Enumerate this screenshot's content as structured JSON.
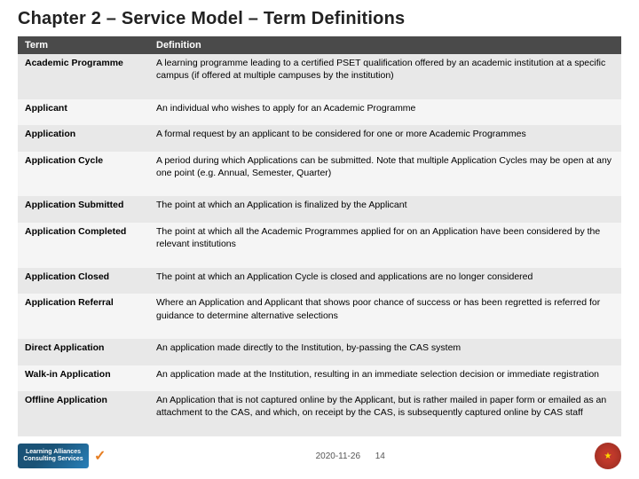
{
  "header": {
    "title": "Chapter 2 – Service Model – Term Definitions"
  },
  "table": {
    "columns": [
      "Term",
      "Definition"
    ],
    "rows": [
      {
        "term": "Academic Programme",
        "definition": "A learning programme leading to a certified PSET qualification offered by an academic institution at a specific campus (if offered at multiple campuses by the institution)"
      },
      {
        "term": "Applicant",
        "definition": "An individual who wishes to apply for an Academic Programme"
      },
      {
        "term": "Application",
        "definition": "A formal request by an applicant to be considered for one or more Academic Programmes"
      },
      {
        "term": "Application Cycle",
        "definition": "A period during which Applications can be submitted. Note that multiple Application Cycles may be open at any one point (e.g. Annual, Semester, Quarter)"
      },
      {
        "term": "Application Submitted",
        "definition": "The point at which an Application is finalized by the Applicant"
      },
      {
        "term": "Application Completed",
        "definition": "The point at which all the Academic Programmes applied for on an Application have been considered by the relevant institutions"
      },
      {
        "term": "Application Closed",
        "definition": "The point at which an Application Cycle is closed and applications are no longer considered"
      },
      {
        "term": "Application Referral",
        "definition": "Where an Application and Applicant that shows poor chance of success or has been regretted is referred for guidance to determine alternative selections"
      },
      {
        "term": "Direct Application",
        "definition": "An application made directly to the Institution, by-passing the CAS system"
      },
      {
        "term": "Walk-in Application",
        "definition": "An application made at the Institution, resulting in an immediate selection decision or immediate registration"
      },
      {
        "term": "Offline Application",
        "definition": "An Application that is not captured online by the Applicant, but is rather mailed in paper form or emailed as an attachment to the CAS, and which, on receipt by the CAS, is subsequently captured online by CAS staff"
      }
    ]
  },
  "footer": {
    "date": "2020-11-26",
    "page": "14",
    "logo_line1": "Learning Alliances",
    "logo_line2": "Consulting Services"
  }
}
